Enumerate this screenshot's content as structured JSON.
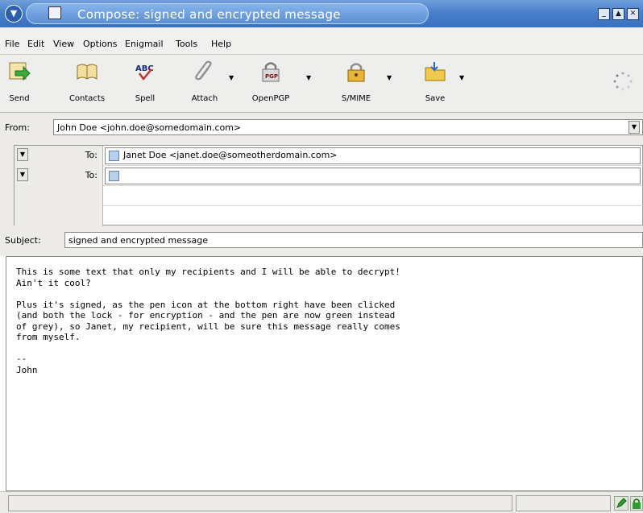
{
  "window": {
    "title": "Compose: signed and encrypted message"
  },
  "menu": [
    "File",
    "Edit",
    "View",
    "Options",
    "Enigmail",
    "Tools",
    "Help"
  ],
  "toolbar": {
    "send": "Send",
    "contacts": "Contacts",
    "spell": "Spell",
    "attach": "Attach",
    "openpgp": "OpenPGP",
    "smime": "S/MIME",
    "save": "Save",
    "pgp_badge": "PGP"
  },
  "headers": {
    "from_label": "From:",
    "from_value": "John Doe <john.doe@somedomain.com>",
    "recipients": [
      {
        "type": "To:",
        "value": "Janet Doe <janet.doe@someotherdomain.com>"
      },
      {
        "type": "To:",
        "value": ""
      }
    ],
    "subject_label": "Subject:",
    "subject_value": "signed and encrypted message"
  },
  "body": {
    "text": "This is some text that only my recipients and I will be able to decrypt!\nAin't it cool?\n\nPlus it's signed, as the pen icon at the bottom right have been clicked\n(and both the lock - for encryption - and the pen are now green instead\nof grey), so Janet, my recipient, will be sure this message really comes\nfrom myself.\n\n--\nJohn"
  },
  "icons": {
    "send": "send-icon",
    "contacts": "address-book-icon",
    "spell": "spellcheck-icon",
    "attach": "paperclip-icon",
    "openpgp": "pgp-lock-icon",
    "smime": "padlock-icon",
    "save": "save-folder-icon",
    "status_sign": "pen-icon",
    "status_encrypt": "lock-icon"
  },
  "colors": {
    "titlebar": "#4a7fcb",
    "status_active": "#2e9e2e"
  }
}
